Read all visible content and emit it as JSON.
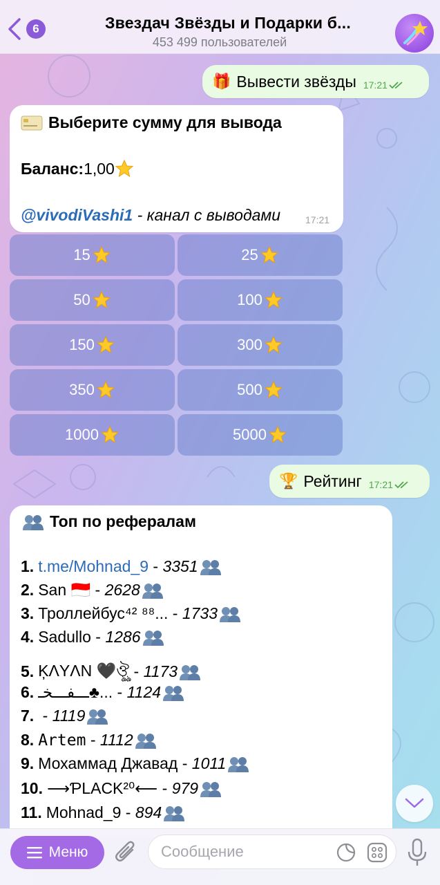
{
  "header": {
    "back_badge": "6",
    "title": "Звездач       Звёзды и Подарки б...",
    "subtitle": "453 499 пользователей"
  },
  "messages": {
    "withdraw_request": {
      "emoji": "🎁",
      "text": "Вывести звёзды",
      "time": "17:21"
    },
    "withdraw_choice": {
      "title": "Выберите сумму для вывода",
      "balance_label": "Баланс:",
      "balance_value": " 1,00",
      "channel_link": "@vivodiVashi1",
      "channel_desc": " - канал с выводами",
      "time": "17:21"
    },
    "rating_request": {
      "emoji": "🏆",
      "text": "Рейтинг",
      "time": "17:21"
    },
    "rating": {
      "title": "Топ по рефералам",
      "rows": [
        {
          "num": "1.",
          "name": "t.me/Mohnad_9",
          "score": "3351"
        },
        {
          "num": "2.",
          "name": "San 🇮🇩",
          "score": "2628"
        },
        {
          "num": "3.",
          "name": "Троллейбус⁴² ⁸⁸...",
          "score": "1733"
        },
        {
          "num": "4.",
          "name": "Sadullo",
          "score": "1286"
        },
        {
          "num": "5.",
          "name": "ĶΛYΛN 🖤ঔৣ",
          "score": "1173"
        },
        {
          "num": "6.",
          "name": "ـ‌ـ‌ـفـ‌ـ‌ـخـ♣...",
          "score": "1124"
        },
        {
          "num": "7.",
          "name": "",
          "score": "1119"
        },
        {
          "num": "8.",
          "name": "Artem",
          "score": "1112"
        },
        {
          "num": "9.",
          "name": "Мохаммад Джавад",
          "score": "1011"
        },
        {
          "num": "10.",
          "name": "⟶ƤLACK²⁰⟵",
          "score": "979"
        },
        {
          "num": "11.",
          "name": "Mohnad_9",
          "score": "894"
        }
      ]
    }
  },
  "keyboard": {
    "buttons": [
      "15",
      "25",
      "50",
      "100",
      "150",
      "300",
      "350",
      "500",
      "1000",
      "5000"
    ]
  },
  "input": {
    "menu_label": "Меню",
    "placeholder": "Сообщение"
  },
  "colors": {
    "accent": "#a46ae6",
    "outgoing_bubble": "#e9fbe2",
    "link": "#2c6bb7"
  }
}
